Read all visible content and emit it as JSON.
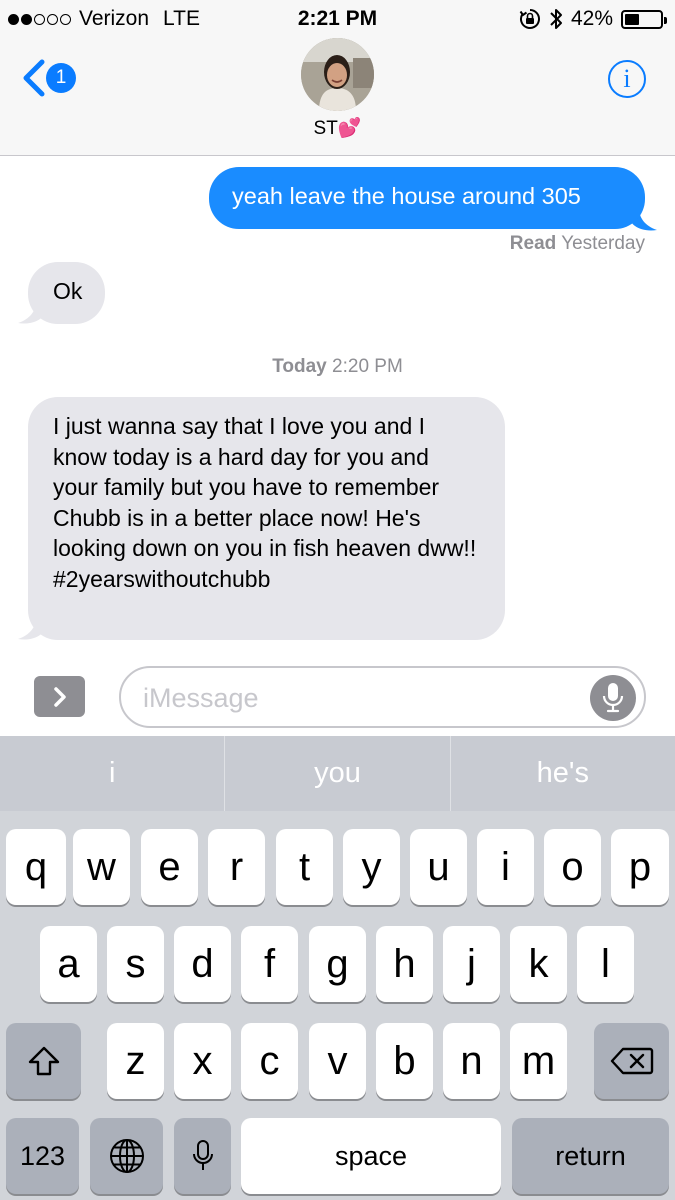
{
  "status_bar": {
    "carrier": "Verizon",
    "network": "LTE",
    "time": "2:21 PM",
    "battery_percent": "42%",
    "battery_level": 0.42,
    "signal_bars_filled": 2,
    "signal_bars_total": 5
  },
  "header": {
    "back_badge": "1",
    "contact_name": "ST💕",
    "info_icon": "i"
  },
  "messages": [
    {
      "direction": "sent",
      "text": "yeah leave the house around 305"
    },
    {
      "direction": "received",
      "text": "Ok"
    },
    {
      "direction": "received",
      "text": "I just wanna say that I love you and I know today is a hard day for you and your family but you have to remember Chubb is in a better place now! He's looking down on you in fish heaven dww!! #2yearswithoutchubb"
    }
  ],
  "read_receipt": {
    "label": "Read",
    "when": "Yesterday"
  },
  "timestamp": {
    "day": "Today",
    "time": "2:20 PM"
  },
  "compose": {
    "placeholder": "iMessage"
  },
  "keyboard": {
    "suggestions": [
      "i",
      "you",
      "he's"
    ],
    "row1": [
      "q",
      "w",
      "e",
      "r",
      "t",
      "y",
      "u",
      "i",
      "o",
      "p"
    ],
    "row2": [
      "a",
      "s",
      "d",
      "f",
      "g",
      "h",
      "j",
      "k",
      "l"
    ],
    "row3": [
      "z",
      "x",
      "c",
      "v",
      "b",
      "n",
      "m"
    ],
    "numbers_key": "123",
    "space_key": "space",
    "return_key": "return"
  },
  "colors": {
    "sent_bubble": "#1a8cff",
    "received_bubble": "#e6e6eb",
    "accent": "#0a7cff"
  }
}
